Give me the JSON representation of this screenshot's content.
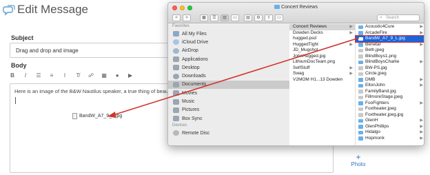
{
  "app": {
    "title": "Edit Message",
    "subject_label": "Subject",
    "subject_value": "Drag and drop and image",
    "body_label": "Body",
    "toolbar": [
      "B",
      "I",
      "☰",
      "≡",
      "I",
      "T̸",
      "☍",
      "▦",
      "●",
      "▶"
    ],
    "body_text": "Here is an image of the B&W Nautilus speaker, a true thing of beauty:",
    "attachment_name": "BandW_A7_9_L.jpg",
    "photo_label": "Photo",
    "photo_plus": "+"
  },
  "finder": {
    "window_title": "Concert Reviews",
    "search_placeholder": "Search",
    "toolbar": {
      "back": "<",
      "forward": ">",
      "view_icons": "▦",
      "view_list": "☰",
      "view_columns": "▥",
      "view_gallery": "▭",
      "arrange": "▤",
      "action": "⚙",
      "share": "⇧",
      "tags": "▭"
    },
    "sidebar_heading_favorites": "Favorites",
    "sidebar_heading_devices": "Devices",
    "favorites": [
      "All My Files",
      "iCloud Drive",
      "AirDrop",
      "Applications",
      "Desktop",
      "Downloads",
      "Documents",
      "Movies",
      "Music",
      "Pictures",
      "Box Sync"
    ],
    "selected_favorite": "Documents",
    "devices": [
      "Remote Disc"
    ],
    "column1": [
      {
        "name": "Concert Reviews",
        "folder": true,
        "selected": true
      },
      {
        "name": "Dowden Decks",
        "folder": true
      },
      {
        "name": "hugged.psd",
        "folder": false
      },
      {
        "name": "HuggedTight",
        "folder": true
      },
      {
        "name": "JD_Mugshot",
        "folder": false
      },
      {
        "name": "JohnHugged.jpg",
        "folder": false
      },
      {
        "name": "LithiumDocTeam.png",
        "folder": false
      },
      {
        "name": "SelfStuff",
        "folder": true
      },
      {
        "name": "Swag",
        "folder": true
      },
      {
        "name": "V2MOM H1...13 Dowden",
        "folder": false
      }
    ],
    "column2": [
      {
        "name": "Acoustic4Cure",
        "folder": true
      },
      {
        "name": "ArcadeFire",
        "folder": true
      },
      {
        "name": "BandW_A7_9_L.jpg",
        "folder": false,
        "highlight": true
      },
      {
        "name": "Benetar",
        "folder": true
      },
      {
        "name": "Beth.jpeg",
        "folder": false
      },
      {
        "name": "BlindBoys1.png",
        "folder": false
      },
      {
        "name": "BlindBoysCharlie",
        "folder": true
      },
      {
        "name": "BW-PS.jpg",
        "folder": false
      },
      {
        "name": "Circle.jpeg",
        "folder": false
      },
      {
        "name": "DMB",
        "folder": true
      },
      {
        "name": "EltonJohn",
        "folder": true
      },
      {
        "name": "FamilyBand.jpg",
        "folder": false
      },
      {
        "name": "FillmoreStage.jpeg",
        "folder": false
      },
      {
        "name": "FooFighters",
        "folder": true
      },
      {
        "name": "Foxtheater.jpeg",
        "folder": false
      },
      {
        "name": "Foxtheater.jpeg.jpg",
        "folder": false
      },
      {
        "name": "GlenH",
        "folder": true
      },
      {
        "name": "GlenPhillips",
        "folder": true
      },
      {
        "name": "Hidalgo",
        "folder": true
      },
      {
        "name": "Hopmonk",
        "folder": true
      }
    ]
  },
  "colors": {
    "accent_blue": "#1f63d6",
    "arrow_red": "#d0342c",
    "folder_blue": "#6ab0e8"
  }
}
